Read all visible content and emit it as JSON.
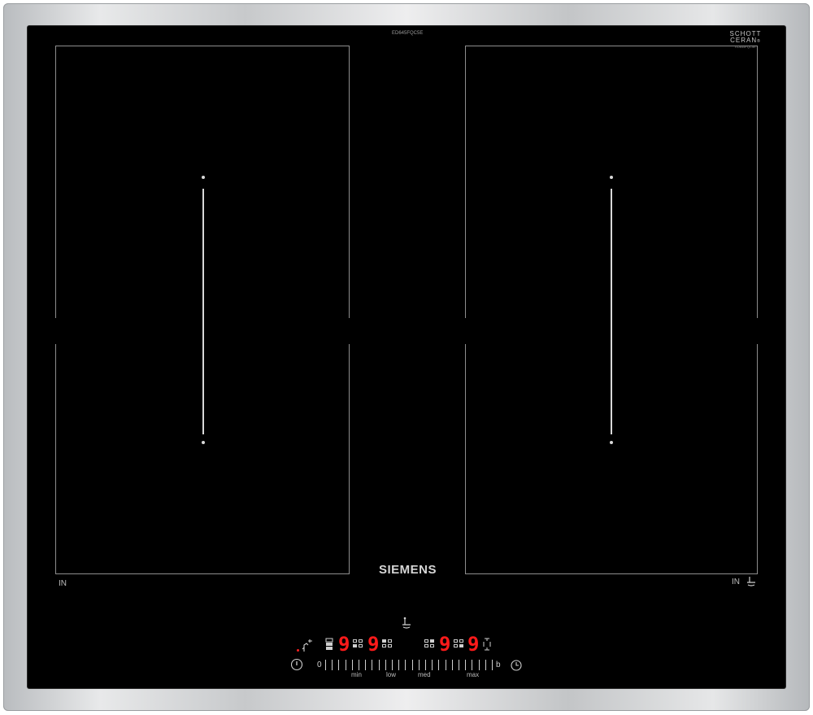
{
  "hob": {
    "model_code": "ED645FQC5E",
    "glass_brand_top": "SCHOTT",
    "glass_brand_bottom": "CERAN",
    "glass_brand_mark": "®",
    "glass_code": "ED645FQC5E",
    "brand": "SIEMENS",
    "zone_left_label": "IN",
    "zone_right_label": "IN"
  },
  "panel": {
    "display_1": "9",
    "display_2": "9",
    "display_3": "9",
    "display_4": "9",
    "slider_start": "0",
    "slider_end": "b",
    "slider_min": "min",
    "slider_low": "low",
    "slider_med": "med",
    "slider_max": "max",
    "digit_color": "#ff1a1a"
  }
}
